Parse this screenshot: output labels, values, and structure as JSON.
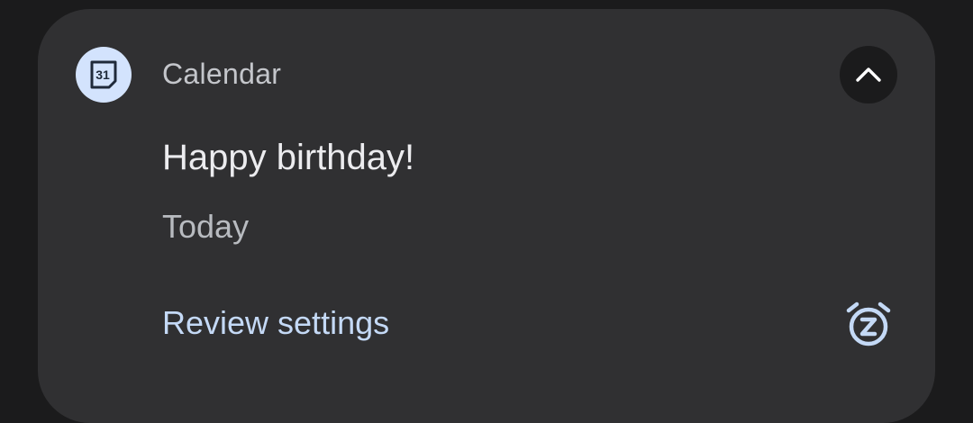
{
  "notification": {
    "app_icon": "calendar-31-icon",
    "app_icon_text": "31",
    "app_name": "Calendar",
    "title": "Happy birthday!",
    "subtitle": "Today",
    "action_label": "Review settings",
    "collapse_icon": "chevron-up-icon",
    "snooze_icon": "snooze-alarm-icon",
    "accent_color": "#c4d9f6",
    "icon_bg_color": "#d3e3fd",
    "card_color": "#303032"
  }
}
